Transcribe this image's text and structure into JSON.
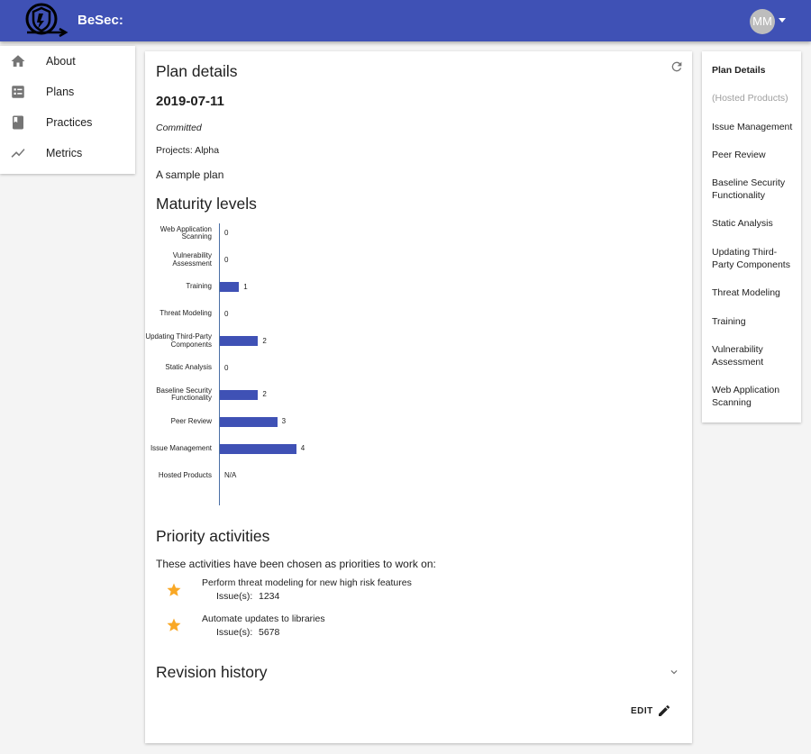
{
  "header": {
    "brand": "BeSec:",
    "avatar_initials": "MM"
  },
  "sidebar": {
    "items": [
      {
        "label": "About",
        "icon": "home-icon"
      },
      {
        "label": "Plans",
        "icon": "list-icon"
      },
      {
        "label": "Practices",
        "icon": "book-icon"
      },
      {
        "label": "Metrics",
        "icon": "trending-icon"
      }
    ]
  },
  "plan": {
    "title": "Plan details",
    "date": "2019-07-11",
    "status": "Committed",
    "projects": "Projects: Alpha",
    "description": "A sample plan"
  },
  "maturity": {
    "heading": "Maturity levels"
  },
  "chart_data": {
    "type": "bar",
    "orientation": "horizontal",
    "categories": [
      "Web Application Scanning",
      "Vulnerability Assessment",
      "Training",
      "Threat Modeling",
      "Updating Third-Party Components",
      "Static Analysis",
      "Baseline Security Functionality",
      "Peer Review",
      "Issue Management",
      "Hosted Products"
    ],
    "values": [
      0,
      0,
      1,
      0,
      2,
      0,
      2,
      3,
      4,
      null
    ],
    "value_labels": [
      "0",
      "0",
      "1",
      "0",
      "2",
      "0",
      "2",
      "3",
      "4",
      "N/A"
    ],
    "xlim": [
      0,
      4
    ],
    "color": "#3f51b5"
  },
  "priority": {
    "heading": "Priority activities",
    "intro": "These activities have been chosen as priorities to work on:",
    "issues_label": "Issue(s):",
    "activities": [
      {
        "title": "Perform threat modeling for new high risk features",
        "issues": "1234"
      },
      {
        "title": "Automate updates to libraries",
        "issues": "5678"
      }
    ]
  },
  "revision": {
    "heading": "Revision history"
  },
  "actions": {
    "edit_label": "EDIT"
  },
  "toc": {
    "items": [
      "Plan Details",
      "(Hosted Products)",
      "Issue Management",
      "Peer Review",
      "Baseline Security Functionality",
      "Static Analysis",
      "Updating Third-Party Components",
      "Threat Modeling",
      "Training",
      "Vulnerability Assessment",
      "Web Application Scanning"
    ]
  }
}
